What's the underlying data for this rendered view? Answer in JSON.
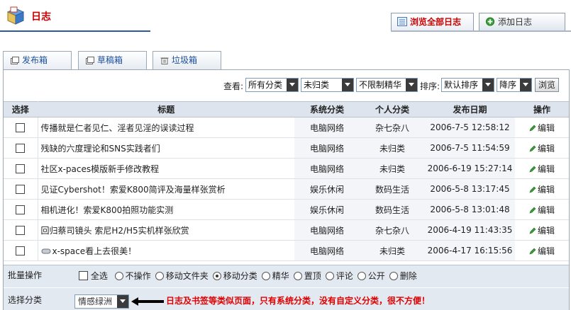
{
  "app": {
    "title": "日志"
  },
  "top_tabs": [
    {
      "label": "浏览全部日志",
      "icon": "list-icon"
    },
    {
      "label": "添加日志",
      "icon": "add-circle-icon"
    }
  ],
  "sub_tabs": [
    {
      "label": "发布箱",
      "icon": "outbox-icon"
    },
    {
      "label": "草稿箱",
      "icon": "drafts-icon"
    },
    {
      "label": "垃圾箱",
      "icon": "trash-icon"
    }
  ],
  "filters": {
    "view_label": "查看:",
    "category": "所有分类",
    "personal": "未归类",
    "featured": "不限制精华",
    "sort_label": "排序:",
    "sort": "默认排序",
    "order": "降序",
    "browse_button": "浏览"
  },
  "table": {
    "headers": {
      "select": "选择",
      "title": "标题",
      "system": "系统分类",
      "personal": "个人分类",
      "date": "发布日期",
      "action": "操作"
    },
    "rows": [
      {
        "title": "传播就是仁者见仁、淫者见淫的误读过程",
        "system": "电脑网络",
        "personal": "杂七杂八",
        "date": "2006-7-5 12:58:12",
        "action": "编辑",
        "attachment": false
      },
      {
        "title": "残缺的六度理论和SNS实践者们",
        "system": "电脑网络",
        "personal": "未归类",
        "date": "2006-7-5 11:54:59",
        "action": "编辑",
        "attachment": false
      },
      {
        "title": "社区x-paces模版新手修改教程",
        "system": "电脑网络",
        "personal": "未归类",
        "date": "2006-6-19 15:27:14",
        "action": "编辑",
        "attachment": false
      },
      {
        "title": "见证Cybershot！索爱K800简评及海量样张赏析",
        "system": "娱乐休闲",
        "personal": "数码生活",
        "date": "2006-5-8 13:17:45",
        "action": "编辑",
        "attachment": false
      },
      {
        "title": "相机进化！索爱K800拍照功能实测",
        "system": "娱乐休闲",
        "personal": "数码生活",
        "date": "2006-5-8 13:01:48",
        "action": "编辑",
        "attachment": false
      },
      {
        "title": "回归蔡司镜头 索尼H2/H5实机样张欣赏",
        "system": "电脑网络",
        "personal": "杂七杂八",
        "date": "2006-4-19 11:43:35",
        "action": "编辑",
        "attachment": false
      },
      {
        "title": "x-space看上去很美！",
        "system": "电脑网络",
        "personal": "未归类",
        "date": "2006-4-17 16:15:56",
        "action": "编辑",
        "attachment": true
      }
    ]
  },
  "batch": {
    "label": "批量操作",
    "select_all": "全选",
    "options": [
      "不操作",
      "移动文件夹",
      "移动分类",
      "精华",
      "置顶",
      "评论",
      "公开",
      "删除"
    ],
    "selected": "移动分类"
  },
  "category_row": {
    "label": "选择分类",
    "value": "情感绿洲",
    "note": "日志及书签等类似页面，只有系统分类，没有自定义分类，很不方便！"
  },
  "colors": {
    "accent": "#c00000",
    "note": "#e00000",
    "link": "#1a4f9c"
  }
}
